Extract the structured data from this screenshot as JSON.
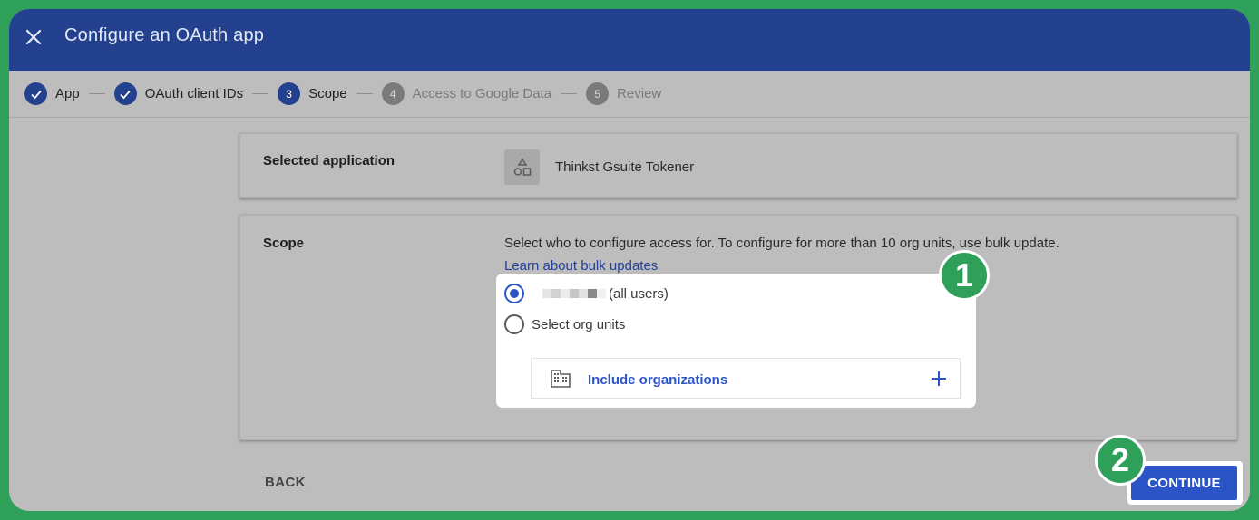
{
  "header": {
    "title": "Configure an OAuth app"
  },
  "stepper": {
    "steps": [
      {
        "number": "1",
        "label": "App",
        "state": "done"
      },
      {
        "number": "2",
        "label": "OAuth client IDs",
        "state": "done"
      },
      {
        "number": "3",
        "label": "Scope",
        "state": "active"
      },
      {
        "number": "4",
        "label": "Access to Google Data",
        "state": "pending"
      },
      {
        "number": "5",
        "label": "Review",
        "state": "pending"
      }
    ]
  },
  "selected_application": {
    "label": "Selected application",
    "app_name": "Thinkst Gsuite Tokener"
  },
  "scope": {
    "label": "Scope",
    "description": "Select who to configure access for. To configure for more than 10 org units, use bulk update.",
    "link": "Learn about bulk updates",
    "options": [
      {
        "label": "(all users)",
        "checked": true
      },
      {
        "label": "Select org units",
        "checked": false
      }
    ],
    "include_label": "Include organizations"
  },
  "callouts": {
    "badge_1": "1",
    "badge_2": "2"
  },
  "footer": {
    "back_label": "BACK",
    "continue_label": "CONTINUE"
  },
  "colors": {
    "header_bg": "#23418f",
    "accent": "#2b55c7",
    "callout": "#2ea05a"
  }
}
